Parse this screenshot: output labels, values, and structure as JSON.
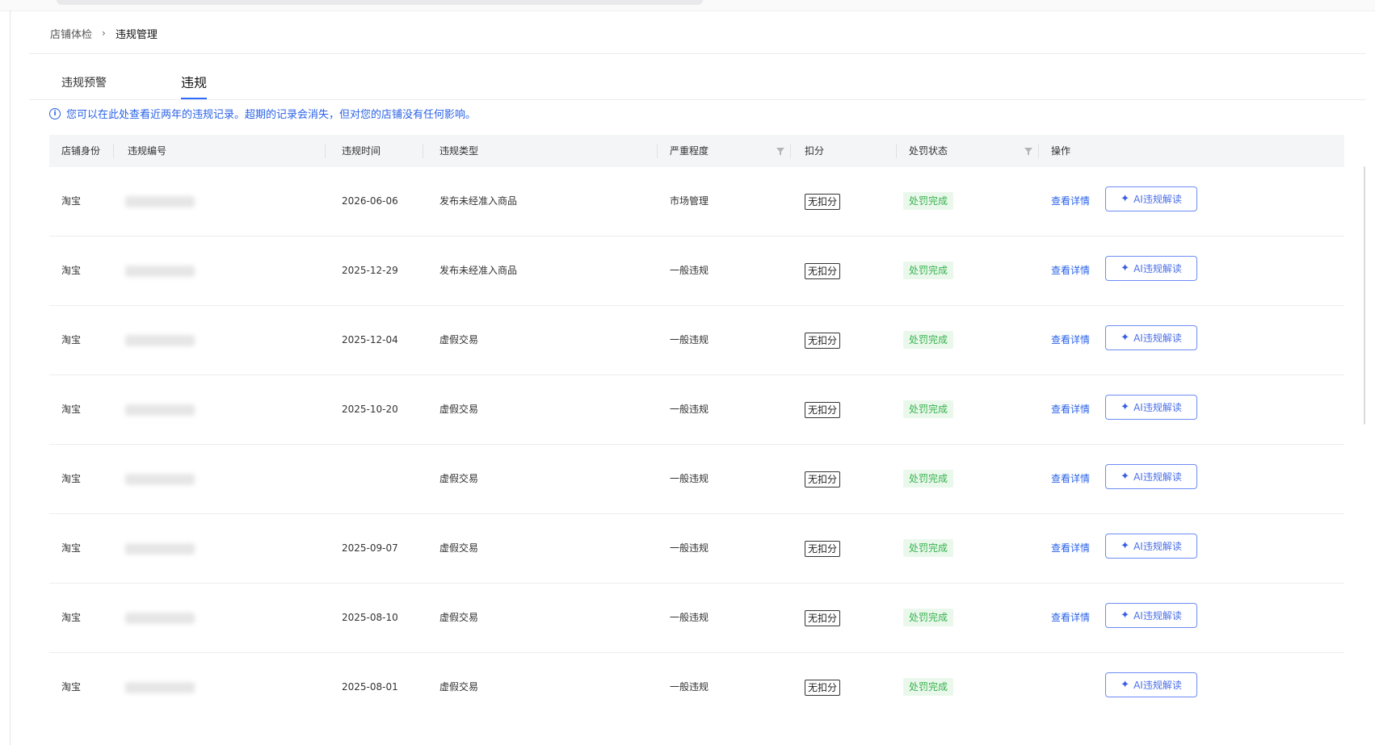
{
  "breadcrumb": {
    "parent": "店铺体检",
    "separator": "›",
    "current": "违规管理"
  },
  "tabs": [
    {
      "label": "违规预警",
      "active": false
    },
    {
      "label": "违规",
      "active": true
    }
  ],
  "notice": {
    "icon": "info-icon",
    "text": "您可以在此处查看近两年的违规记录。超期的记录会消失，但对您的店铺没有任何影响。"
  },
  "table": {
    "columns": {
      "shop_identity": "店铺身份",
      "violation_id": "违规编号",
      "time": "违规时间",
      "type": "违规类型",
      "severity": "严重程度",
      "deduction": "扣分",
      "penalty_status": "处罚状态",
      "actions": "操作"
    },
    "rows": [
      {
        "shop": "淘宝",
        "time": "2026-06-06",
        "type": "发布未经准入商品",
        "severity": "市场管理",
        "deduction": "无扣分",
        "status": "处罚完成",
        "detail": "查看详情",
        "ai": "AI违规解读"
      },
      {
        "shop": "淘宝",
        "time": "2025-12-29",
        "type": "发布未经准入商品",
        "severity": "一般违规",
        "deduction": "无扣分",
        "status": "处罚完成",
        "detail": "查看详情",
        "ai": "AI违规解读"
      },
      {
        "shop": "淘宝",
        "time": "2025-12-04",
        "type": "虚假交易",
        "severity": "一般违规",
        "deduction": "无扣分",
        "status": "处罚完成",
        "detail": "查看详情",
        "ai": "AI违规解读"
      },
      {
        "shop": "淘宝",
        "time": "2025-10-20",
        "type": "虚假交易",
        "severity": "一般违规",
        "deduction": "无扣分",
        "status": "处罚完成",
        "detail": "查看详情",
        "ai": "AI违规解读"
      },
      {
        "shop": "淘宝",
        "time": "",
        "type": "虚假交易",
        "severity": "一般违规",
        "deduction": "无扣分",
        "status": "处罚完成",
        "detail": "查看详情",
        "ai": "AI违规解读"
      },
      {
        "shop": "淘宝",
        "time": "2025-09-07",
        "type": "虚假交易",
        "severity": "一般违规",
        "deduction": "无扣分",
        "status": "处罚完成",
        "detail": "查看详情",
        "ai": "AI违规解读"
      },
      {
        "shop": "淘宝",
        "time": "2025-08-10",
        "type": "虚假交易",
        "severity": "一般违规",
        "deduction": "无扣分",
        "status": "处罚完成",
        "detail": "查看详情",
        "ai": "AI违规解读"
      },
      {
        "shop": "淘宝",
        "time": "2025-08-01",
        "type": "虚假交易",
        "severity": "一般违规",
        "deduction": "无扣分",
        "status": "处罚完成",
        "detail": "",
        "ai": "AI违规解读"
      }
    ]
  },
  "icons": {
    "filter": "filter-icon",
    "ai": "sparkle-icon",
    "ai_glyph": "✦"
  },
  "colors": {
    "primary": "#2a62e8",
    "status_bg": "#eaf8ec",
    "status_text": "#37b24d",
    "ai_border": "#6d8cf5"
  }
}
